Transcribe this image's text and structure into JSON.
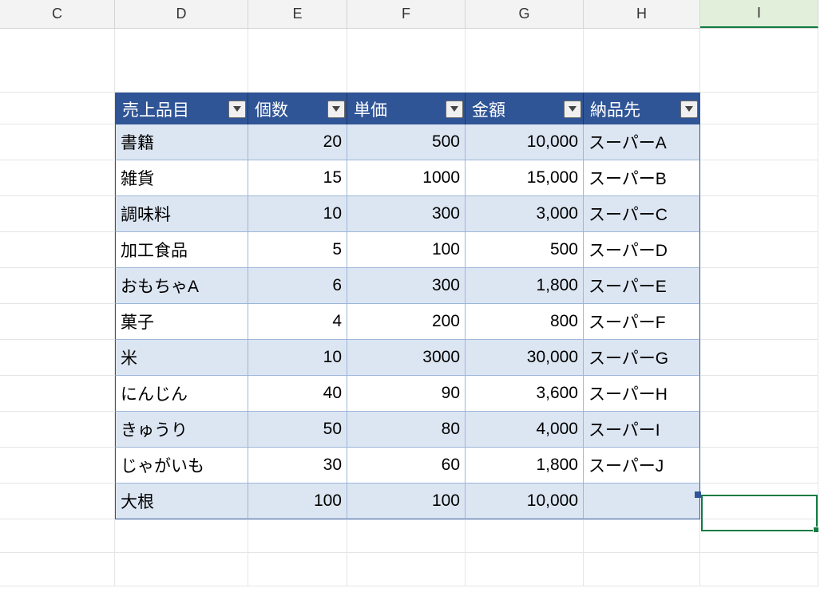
{
  "columns": [
    "C",
    "D",
    "E",
    "F",
    "G",
    "H",
    "I"
  ],
  "active_column": "I",
  "table": {
    "headers": [
      "売上品目",
      "個数",
      "単価",
      "金額",
      "納品先"
    ],
    "rows": [
      {
        "item": "書籍",
        "qty": "20",
        "unit": "500",
        "amount": "10,000",
        "dest": "スーパーA"
      },
      {
        "item": "雑貨",
        "qty": "15",
        "unit": "1000",
        "amount": "15,000",
        "dest": "スーパーB"
      },
      {
        "item": "調味料",
        "qty": "10",
        "unit": "300",
        "amount": "3,000",
        "dest": "スーパーC"
      },
      {
        "item": "加工食品",
        "qty": "5",
        "unit": "100",
        "amount": "500",
        "dest": "スーパーD"
      },
      {
        "item": "おもちゃA",
        "qty": "6",
        "unit": "300",
        "amount": "1,800",
        "dest": "スーパーE"
      },
      {
        "item": "菓子",
        "qty": "4",
        "unit": "200",
        "amount": "800",
        "dest": "スーパーF"
      },
      {
        "item": "米",
        "qty": "10",
        "unit": "3000",
        "amount": "30,000",
        "dest": "スーパーG"
      },
      {
        "item": "にんじん",
        "qty": "40",
        "unit": "90",
        "amount": "3,600",
        "dest": "スーパーH"
      },
      {
        "item": "きゅうり",
        "qty": "50",
        "unit": "80",
        "amount": "4,000",
        "dest": "スーパーI"
      },
      {
        "item": "じゃがいも",
        "qty": "30",
        "unit": "60",
        "amount": "1,800",
        "dest": "スーパーJ"
      },
      {
        "item": "大根",
        "qty": "100",
        "unit": "100",
        "amount": "10,000",
        "dest": ""
      }
    ]
  }
}
